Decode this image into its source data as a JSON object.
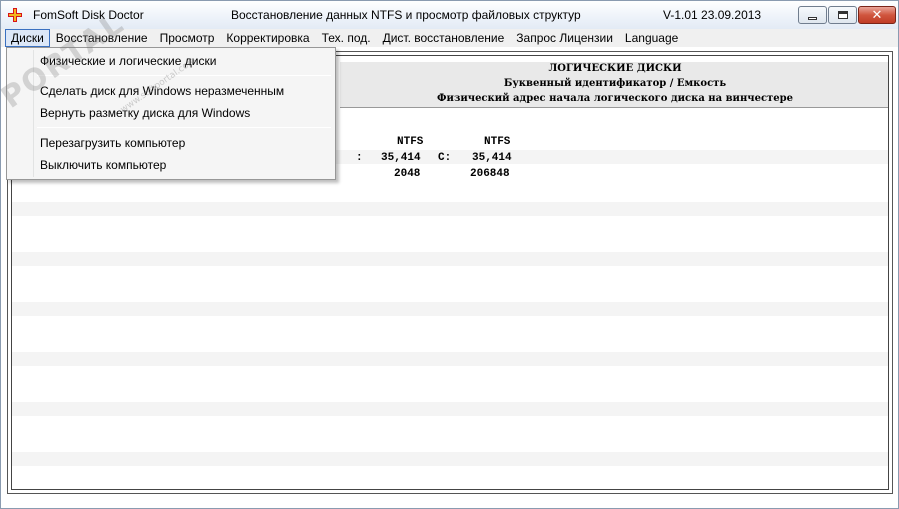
{
  "window": {
    "app_name": "FomSoft Disk Doctor",
    "description": "Восстановление данных NTFS и просмотр файловых структур",
    "version": "V-1.01  23.09.2013"
  },
  "menu": [
    {
      "label": "Диски"
    },
    {
      "label": "Восстановление"
    },
    {
      "label": "Просмотр"
    },
    {
      "label": "Корректировка"
    },
    {
      "label": "Тех. под."
    },
    {
      "label": "Дист. восстановление"
    },
    {
      "label": "Запрос Лицензии"
    },
    {
      "label": "Language"
    }
  ],
  "dropdown": {
    "items": [
      {
        "label": "Физические и логические диски"
      },
      {
        "label": "Сделать диск для Windows неразмеченным"
      },
      {
        "label": "Вернуть разметку диска для Windows"
      },
      {
        "label": "Перезагрузить компьютер"
      },
      {
        "label": "Выключить компьютер"
      }
    ]
  },
  "logical_disks": {
    "header_title": "ЛОГИЧЕСКИЕ ДИСКИ",
    "header_line2": "Буквенный идентификатор / Емкость",
    "header_line3": "Физический адрес начала логического диска на винчестере",
    "columns": [
      {
        "fs": "NTFS",
        "prefix": ":",
        "size": "35,414",
        "address": "2048"
      },
      {
        "fs": "NTFS",
        "prefix": "C:",
        "size": "35,414",
        "address": "206848"
      }
    ]
  },
  "watermark": {
    "text": "PORTAL",
    "sub": "www.softportal.com"
  },
  "colors": {
    "menu_active_border": "#3a70c0",
    "close_button": "#c03c26",
    "header_band": "#e9e9e9"
  }
}
